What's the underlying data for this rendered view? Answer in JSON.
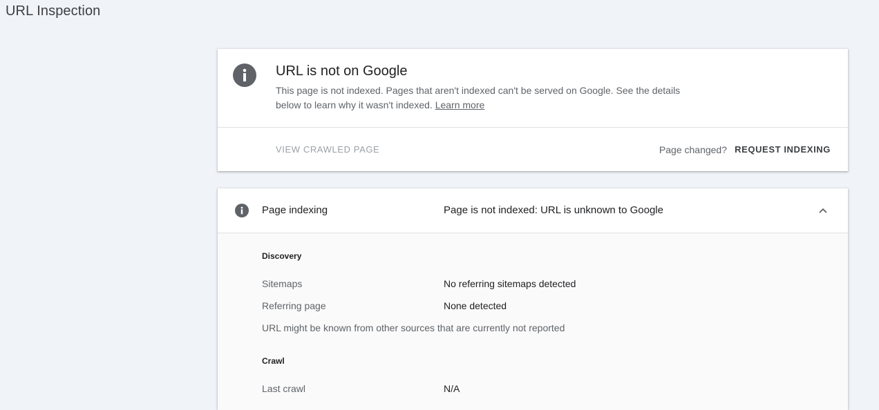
{
  "page": {
    "title": "URL Inspection"
  },
  "status_card": {
    "icon": "info-icon",
    "title": "URL is not on Google",
    "description": "This page is not indexed. Pages that aren't indexed can't be served on Google. See the details below to learn why it wasn't indexed.",
    "learn_more": "Learn more",
    "view_crawled_page": "VIEW CRAWLED PAGE",
    "page_changed": "Page changed?",
    "request_indexing": "REQUEST INDEXING"
  },
  "indexing_card": {
    "icon": "info-icon",
    "label": "Page indexing",
    "value": "Page is not indexed: URL is unknown to Google",
    "chevron": "chevron-up-icon",
    "discovery": {
      "heading": "Discovery",
      "sitemaps_label": "Sitemaps",
      "sitemaps_value": "No referring sitemaps detected",
      "referring_label": "Referring page",
      "referring_value": "None detected",
      "note": "URL might be known from other sources that are currently not reported"
    },
    "crawl": {
      "heading": "Crawl",
      "last_crawl_label": "Last crawl",
      "last_crawl_value": "N/A"
    }
  },
  "colors": {
    "background": "#f0f3f8",
    "icon": "#5f6368",
    "muted_text": "#5f6368",
    "disabled_text": "#9aa0a6"
  }
}
